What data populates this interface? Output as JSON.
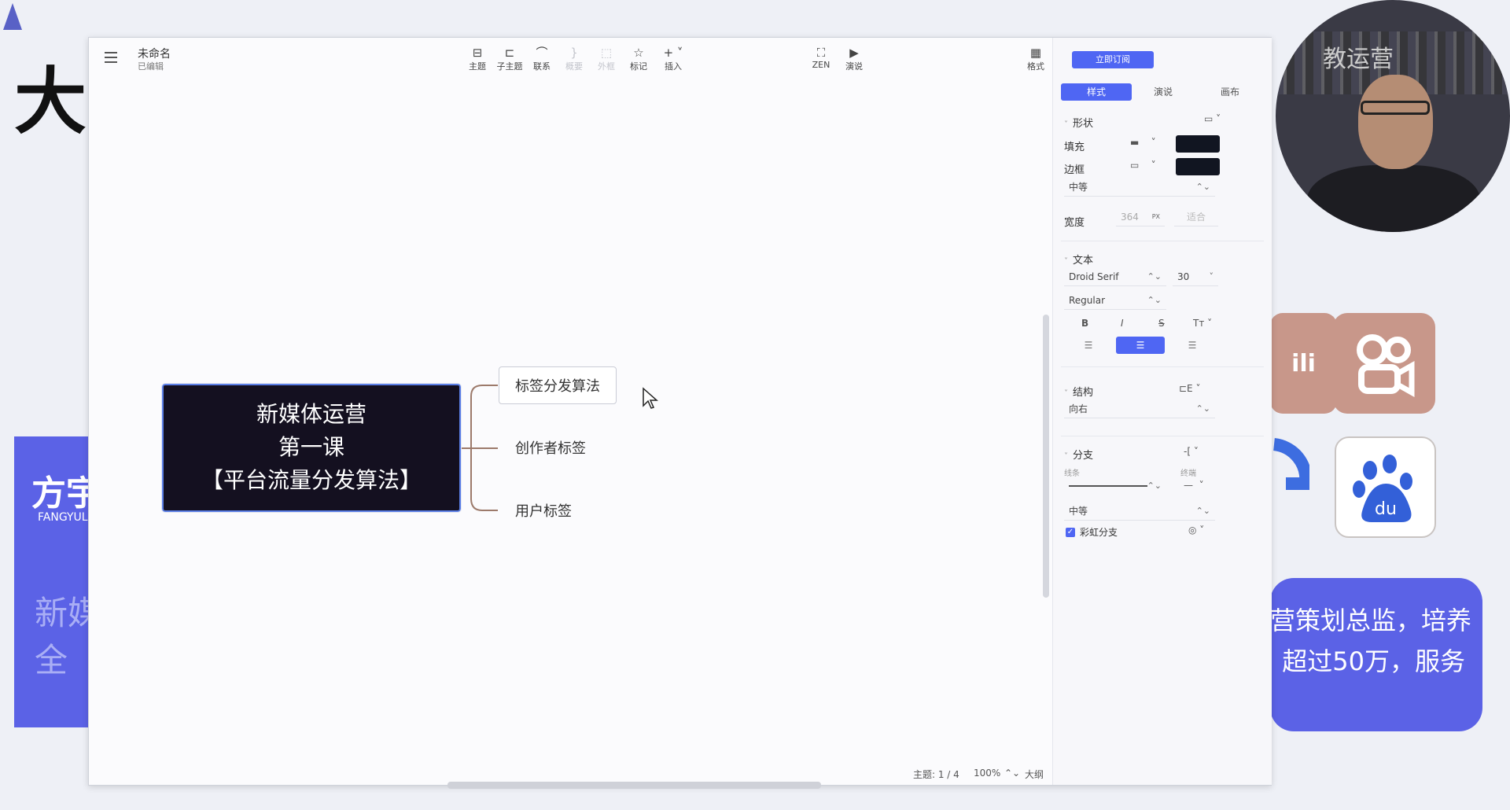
{
  "background": {
    "big_char": "大",
    "left_card": {
      "title": "方宇",
      "sub": "FANGYUL",
      "line1": "新媒",
      "line2": "全"
    },
    "right_card": {
      "line1": "营策划总监，培养",
      "line2": "超过50万，服务"
    },
    "avatar_text": "教运营",
    "app_bili": "ili",
    "app_baidu": "du"
  },
  "window": {
    "doc_title": "未命名",
    "doc_status": "已编辑",
    "toolbar": {
      "topic": "主题",
      "subtopic": "子主题",
      "relation": "联系",
      "summary": "概要",
      "boundary": "外框",
      "marker": "标记",
      "insert": "插入",
      "zen": "ZEN",
      "present": "演说",
      "format": "格式"
    },
    "controls": {
      "minimize": "—",
      "maximize": "☐",
      "close": "✕"
    }
  },
  "mindmap": {
    "root": [
      "新媒体运营",
      "第一课",
      "【平台流量分发算法】"
    ],
    "children": [
      "标签分发算法",
      "创作者标签",
      "用户标签"
    ]
  },
  "status": {
    "topic_count": "主题: 1 / 4",
    "zoom": "100%",
    "outline": "大纲"
  },
  "panel": {
    "subscribe": "立即订阅",
    "tabs": [
      "样式",
      "演说",
      "画布"
    ],
    "shape": {
      "header": "形状",
      "fill_label": "填充",
      "border_label": "边框",
      "border_weight": "中等",
      "width_label": "宽度",
      "width_value": "364",
      "width_unit": "PX",
      "fit": "适合"
    },
    "text": {
      "header": "文本",
      "font": "Droid Serif",
      "size": "30",
      "weight": "Regular",
      "bold": "B",
      "italic": "I",
      "strike": "S",
      "case": "Tт"
    },
    "structure": {
      "header": "结构",
      "direction": "向右"
    },
    "branch": {
      "header": "分支",
      "line_label": "线条",
      "end_label": "终端",
      "weight": "中等",
      "rainbow": "彩虹分支"
    }
  },
  "colors": {
    "accent": "#4f66f3",
    "node_fill": "#141020",
    "branch_line": "#9c7a6b"
  }
}
